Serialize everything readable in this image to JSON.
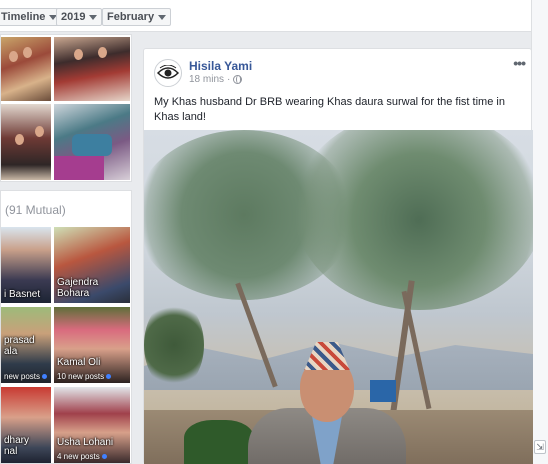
{
  "filters": {
    "timeline_label": "Timeline",
    "year_label": "2019",
    "month_label": "February"
  },
  "friends": {
    "mutual_label": "(91 Mutual)",
    "tiles": [
      {
        "name": "i Basnet",
        "posts": ""
      },
      {
        "name": "Gajendra\nBohara",
        "posts": ""
      },
      {
        "name": "prasad\nala",
        "posts": "new posts"
      },
      {
        "name": "Kamal Oli",
        "posts": "10 new posts"
      },
      {
        "name": "dhary\nnal",
        "posts": ""
      },
      {
        "name": "Usha Lohani",
        "posts": "4 new posts"
      }
    ]
  },
  "post": {
    "author": "Hisila Yami",
    "time": "18 mins",
    "more_label": "•••",
    "caption": "My Khas husband Dr BRB wearing Khas daura surwal for the fist time in Khas land!"
  },
  "colors": {
    "link": "#385898",
    "accent_dot": "#4080ff"
  }
}
